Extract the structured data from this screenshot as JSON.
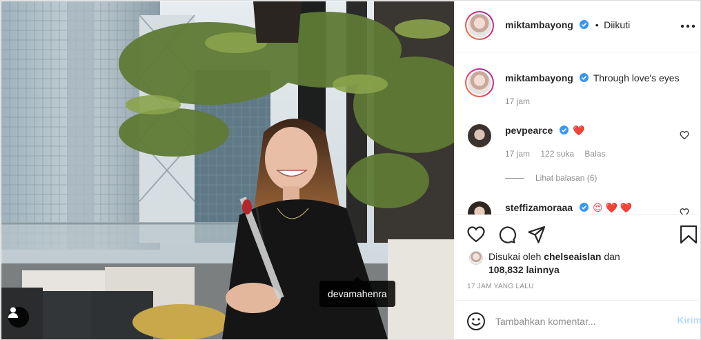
{
  "post": {
    "photo_tag": "devamahenra"
  },
  "header": {
    "username": "miktambayong",
    "separator": "•",
    "follow_status": "Diikuti"
  },
  "caption": {
    "username": "miktambayong",
    "text": "Through love's eyes",
    "time": "17 jam"
  },
  "comments": [
    {
      "username": "pevpearce",
      "text": "❤️",
      "time": "17 jam",
      "likes": "122 suka",
      "reply": "Balas",
      "view_replies": "Lihat balasan (6)"
    },
    {
      "username": "steffizamoraaa",
      "text": "😍 ❤️ ❤️"
    }
  ],
  "likes": {
    "prefix": "Disukai oleh",
    "user": "chelseaislan",
    "conj": "dan",
    "count": "108,832 lainnya"
  },
  "timestamp": "17 JAM YANG LALU",
  "comment_box": {
    "placeholder": "Tambahkan komentar...",
    "send_label": "Kirim"
  },
  "colors": {
    "verified": "#3897f0",
    "heart": "#ed4956",
    "send_disabled": "#b3dbff",
    "meta": "#8e8e8e"
  }
}
